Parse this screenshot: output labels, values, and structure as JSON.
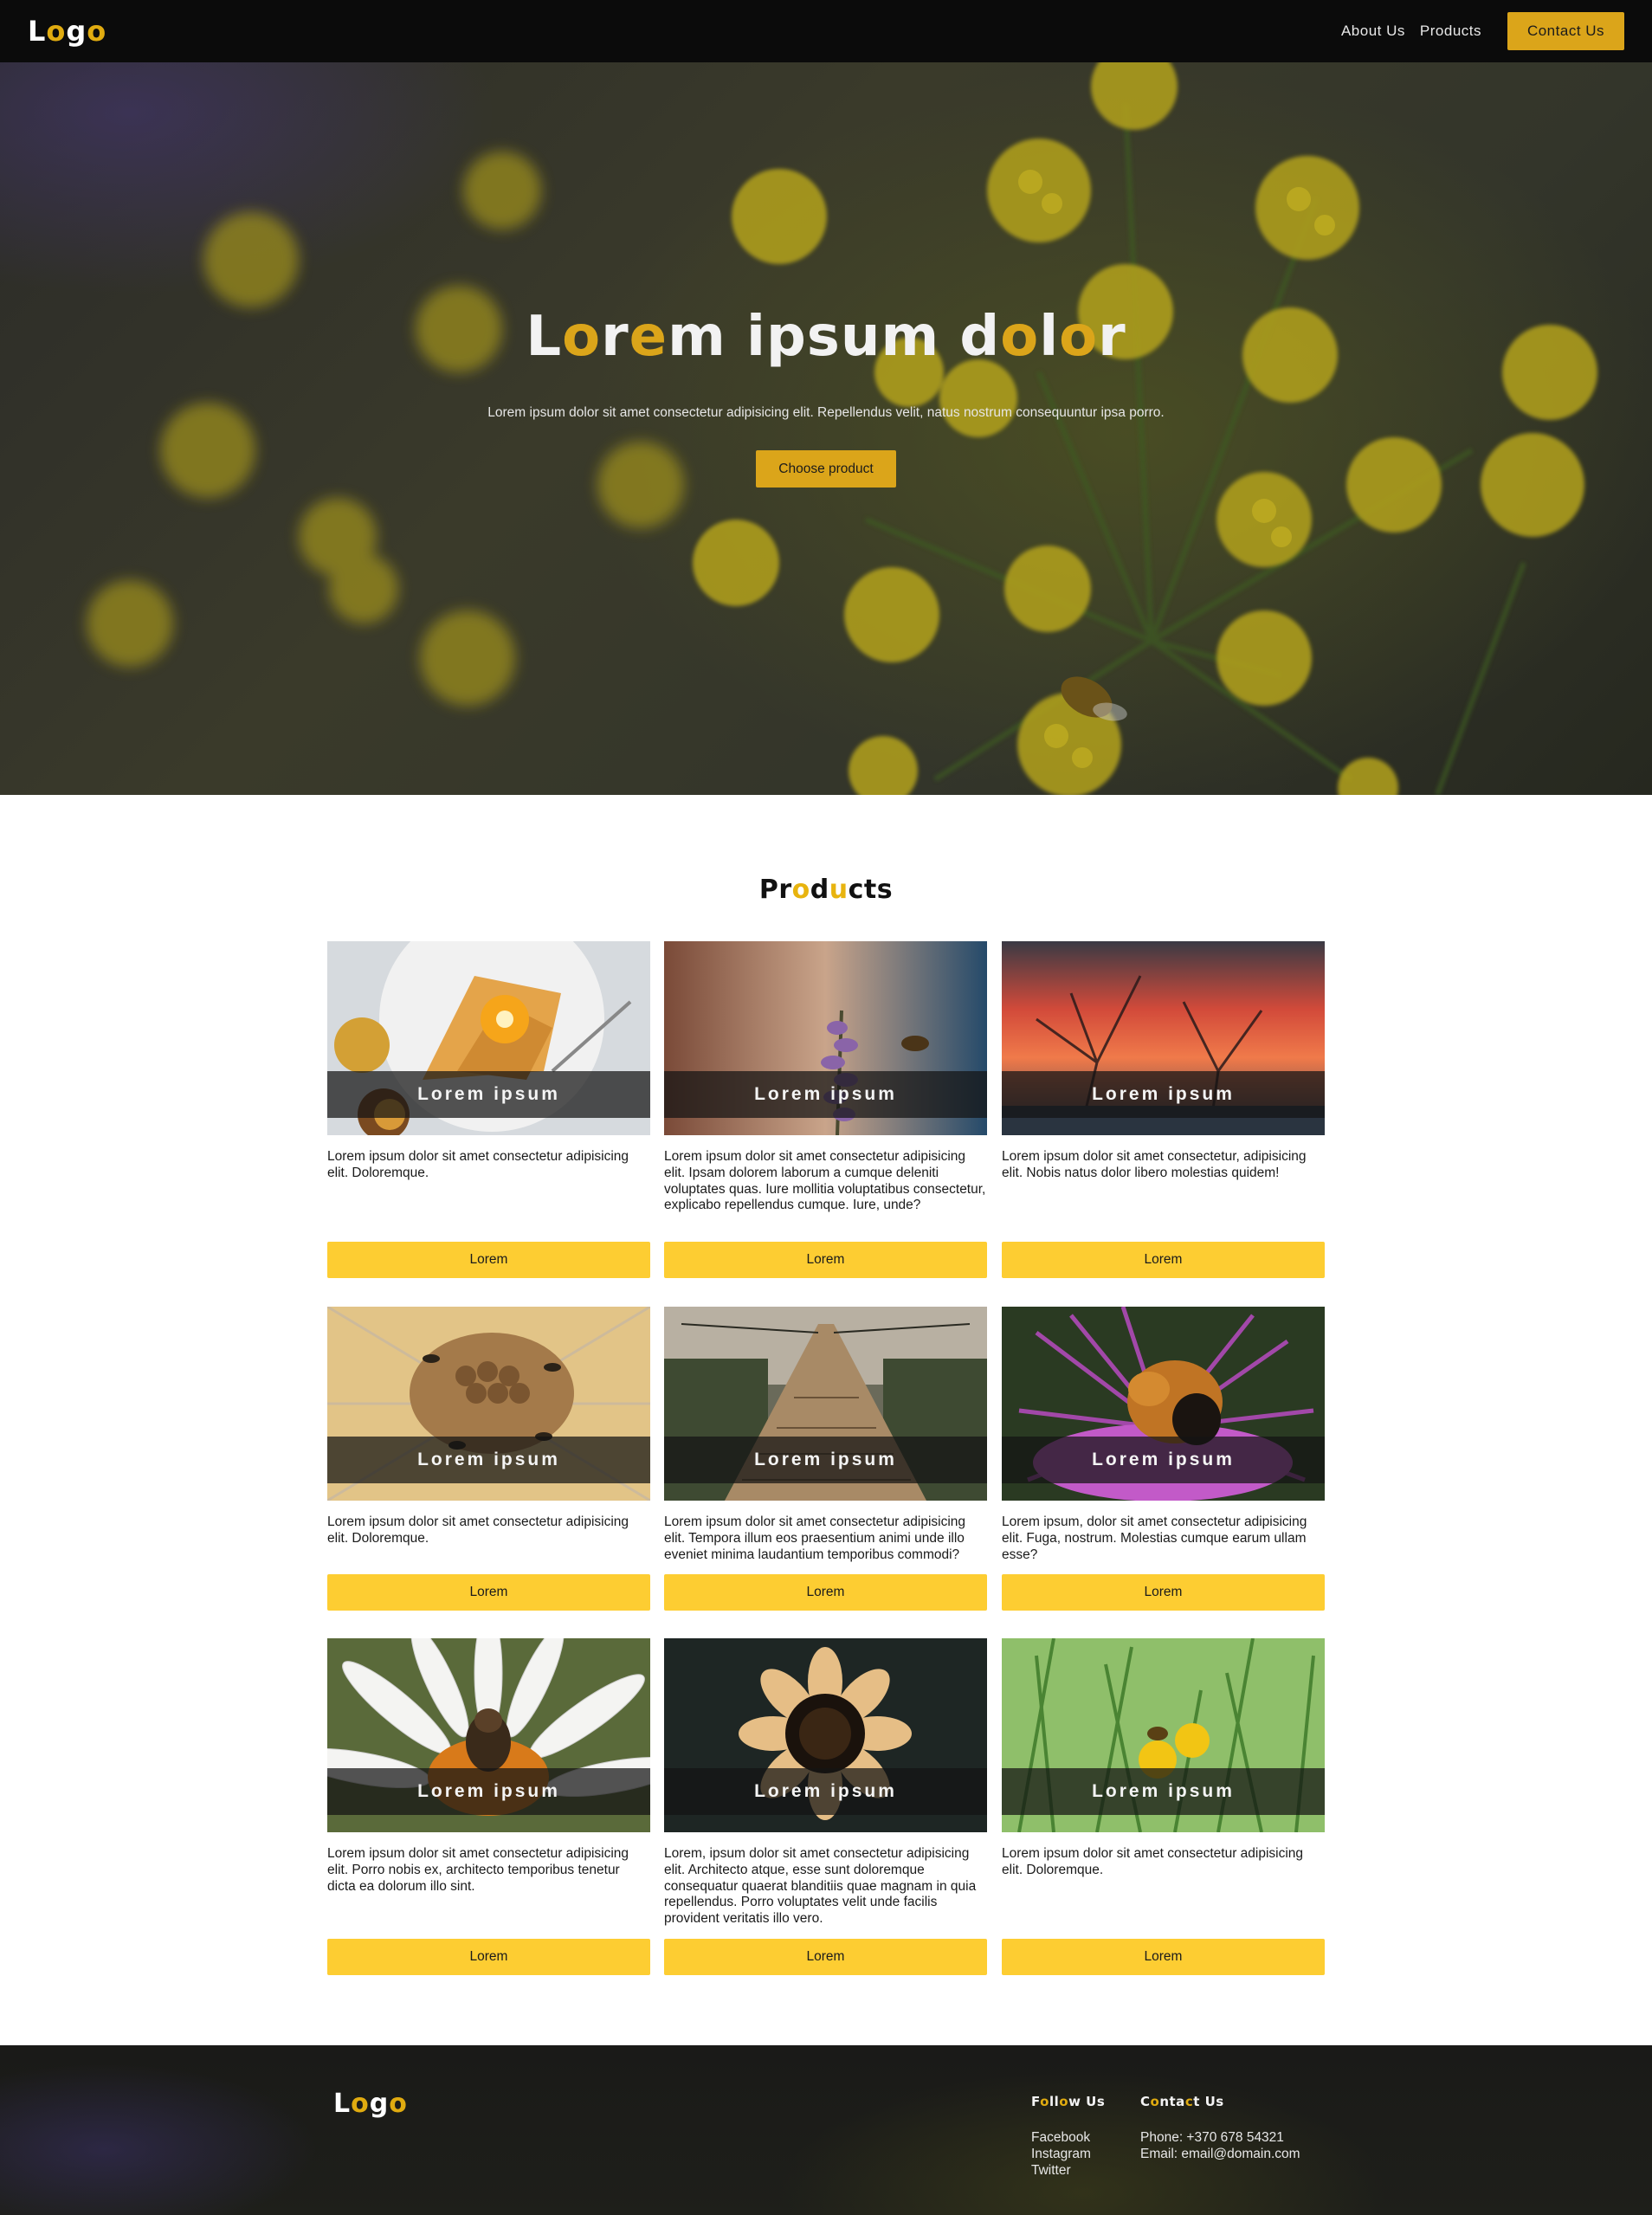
{
  "brand": {
    "logo": [
      "L",
      "o",
      "g",
      "o"
    ]
  },
  "nav": {
    "links": [
      "About Us",
      "Products"
    ],
    "contact_label": "Contact Us"
  },
  "hero": {
    "title_parts": [
      "L",
      "o",
      "r",
      "e",
      "m ipsum d",
      "o",
      "l",
      "o",
      "r"
    ],
    "subtitle": "Lorem ipsum dolor sit amet consectetur adipisicing elit. Repellendus velit, natus nostrum consequuntur ipsa porro.",
    "button_label": "Choose product"
  },
  "products": {
    "title_parts": [
      "Pr",
      "o",
      "d",
      "u",
      "c",
      "ts"
    ],
    "items": [
      {
        "caption": "Lorem ipsum",
        "text": "Lorem ipsum dolor sit amet consectetur adipisicing elit. Doloremque.",
        "button": "Lorem"
      },
      {
        "caption": "Lorem ipsum",
        "text": "Lorem ipsum dolor sit amet consectetur adipisicing elit. Ipsam dolorem laborum a cumque deleniti voluptates quas. Iure mollitia voluptatibus consectetur, explicabo repellendus cumque. Iure, unde?",
        "button": "Lorem"
      },
      {
        "caption": "Lorem ipsum",
        "text": "Lorem ipsum dolor sit amet consectetur, adipisicing elit. Nobis natus dolor libero molestias quidem!",
        "button": "Lorem"
      },
      {
        "caption": "Lorem ipsum",
        "text": "Lorem ipsum dolor sit amet consectetur adipisicing elit. Doloremque.",
        "button": "Lorem"
      },
      {
        "caption": "Lorem ipsum",
        "text": "Lorem ipsum dolor sit amet consectetur adipisicing elit. Tempora illum eos praesentium animi unde illo eveniet minima laudantium temporibus commodi?",
        "button": "Lorem"
      },
      {
        "caption": "Lorem ipsum",
        "text": "Lorem ipsum, dolor sit amet consectetur adipisicing elit. Fuga, nostrum. Molestias cumque earum ullam esse?",
        "button": "Lorem"
      },
      {
        "caption": "Lorem ipsum",
        "text": "Lorem ipsum dolor sit amet consectetur adipisicing elit. Porro nobis ex, architecto temporibus tenetur dicta ea dolorum illo sint.",
        "button": "Lorem"
      },
      {
        "caption": "Lorem ipsum",
        "text": "Lorem, ipsum dolor sit amet consectetur adipisicing elit. Architecto atque, esse sunt doloremque consequatur quaerat blanditiis quae magnam in quia repellendus. Porro voluptates velit unde facilis provident veritatis illo vero.",
        "button": "Lorem"
      },
      {
        "caption": "Lorem ipsum",
        "text": "Lorem ipsum dolor sit amet consectetur adipisicing elit. Doloremque.",
        "button": "Lorem"
      }
    ]
  },
  "footer": {
    "follow_title_parts": [
      "F",
      "o",
      "ll",
      "o",
      "w Us"
    ],
    "follow_links": [
      "Facebook",
      "Instagram",
      "Twitter"
    ],
    "contact_title_parts": [
      "C",
      "o",
      "nta",
      "c",
      "t Us"
    ],
    "phone": "Phone: +370 678 54321",
    "email": "Email: email@domain.com"
  },
  "colors": {
    "accent": "#dba51a",
    "button_yellow": "#fdcd32",
    "dark": "#0b0b0b"
  }
}
